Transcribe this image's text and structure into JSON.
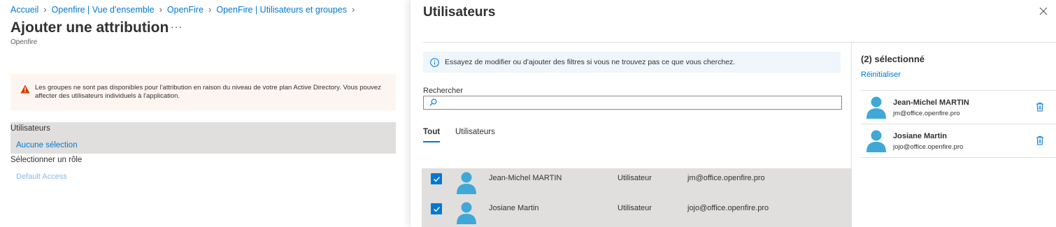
{
  "breadcrumb": [
    {
      "label": "Accueil"
    },
    {
      "label": "Openfire | Vue d'ensemble"
    },
    {
      "label": "OpenFire"
    },
    {
      "label": "OpenFire | Utilisateurs et groupes"
    }
  ],
  "page": {
    "title": "Ajouter une attribution",
    "more_label": "···",
    "subtitle": "Openfire"
  },
  "warning": {
    "icon": "warning-icon",
    "text": "Les groupes ne sont pas disponibles pour l'attribution en raison du niveau de votre plan Active Directory. Vous pouvez affecter des utilisateurs individuels à l'application."
  },
  "assignment": {
    "users_label": "Utilisateurs",
    "users_value": "Aucune sélection",
    "role_label": "Sélectionner un rôle",
    "role_value": "Default Access"
  },
  "panel": {
    "title": "Utilisateurs",
    "info_text": "Essayez de modifier ou d'ajouter des filtres si vous ne trouvez pas ce que vous cherchez.",
    "search_label": "Rechercher",
    "search_value": "",
    "tabs": [
      {
        "label": "Tout",
        "active": true
      },
      {
        "label": "Utilisateurs",
        "active": false
      }
    ],
    "rows": [
      {
        "name": "Jean-Michel MARTIN",
        "type": "Utilisateur",
        "email": "jm@office.openfire.pro",
        "checked": true
      },
      {
        "name": "Josiane Martin",
        "type": "Utilisateur",
        "email": "jojo@office.openfire.pro",
        "checked": true
      }
    ]
  },
  "selected": {
    "title": "(2) sélectionné",
    "reset_label": "Réinitialiser",
    "items": [
      {
        "name": "Jean-Michel MARTIN",
        "email": "jm@office.openfire.pro"
      },
      {
        "name": "Josiane Martin",
        "email": "jojo@office.openfire.pro"
      }
    ]
  },
  "colors": {
    "accent": "#0078d4",
    "avatar": "#3fa8d8",
    "warning": "#d83b01",
    "selection_bg": "#e1dfdd"
  }
}
